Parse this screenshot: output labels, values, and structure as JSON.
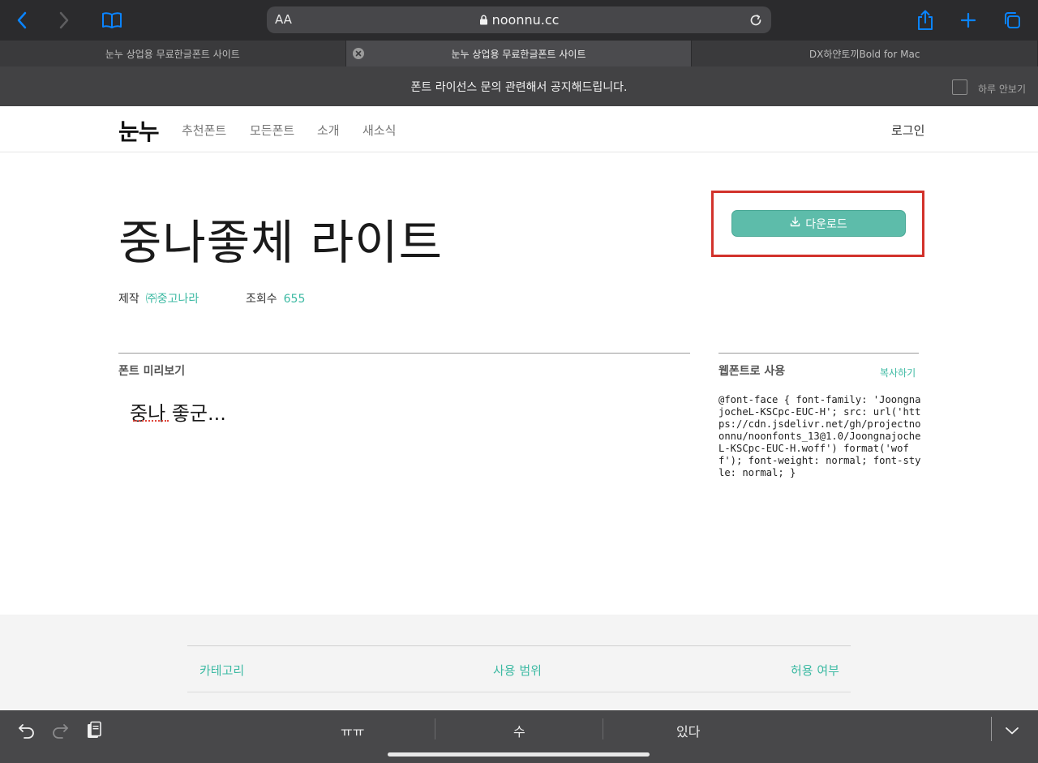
{
  "browser": {
    "aa_label": "AA",
    "url": "noonnu.cc",
    "icons": [
      "back-icon",
      "forward-icon",
      "bookmarks-icon",
      "lock-icon",
      "reload-icon",
      "share-icon",
      "plus-icon",
      "tabs-icon"
    ],
    "tabs": [
      {
        "label": "눈누 상업용 무료한글폰트 사이트"
      },
      {
        "label": "눈누 상업용 무료한글폰트 사이트"
      },
      {
        "label": "DX하얀토끼Bold for Mac"
      }
    ],
    "accent": "#0a84ff"
  },
  "notice": {
    "message": "폰트 라이선스 문의 관련해서 공지해드립니다.",
    "hide_today": "하루 안보기"
  },
  "site": {
    "logo": "눈누",
    "nav": [
      "추천폰트",
      "모든폰트",
      "소개",
      "새소식"
    ],
    "login": "로그인",
    "brand_color": "#3dbaa3"
  },
  "font": {
    "title": "중나좋체 라이트",
    "maker_label": "제작",
    "maker": "㈜중고나라",
    "views_label": "조회수",
    "views": "655",
    "download_label": "다운로드"
  },
  "preview": {
    "label": "폰트 미리보기",
    "text": "중나 좋군..."
  },
  "webfont": {
    "label": "웹폰트로 사용",
    "copy": "복사하기",
    "code": "@font-face { font-family: 'JoongnajocheL-KSCpc-EUC-H'; src: url('https://cdn.jsdelivr.net/gh/projectnoonnu/noonfonts_13@1.0/JoongnajocheL-KSCpc-EUC-H.woff') format('woff'); font-weight: normal; font-style: normal; }"
  },
  "license_table": {
    "headers": [
      "카테고리",
      "사용 범위",
      "허용 여부"
    ]
  },
  "keyboard": {
    "suggestions": [
      "ㅠㅠ",
      "수",
      "있다"
    ],
    "icons": [
      "undo-icon",
      "redo-icon",
      "paste-icon",
      "dismiss-keyboard-icon"
    ]
  }
}
